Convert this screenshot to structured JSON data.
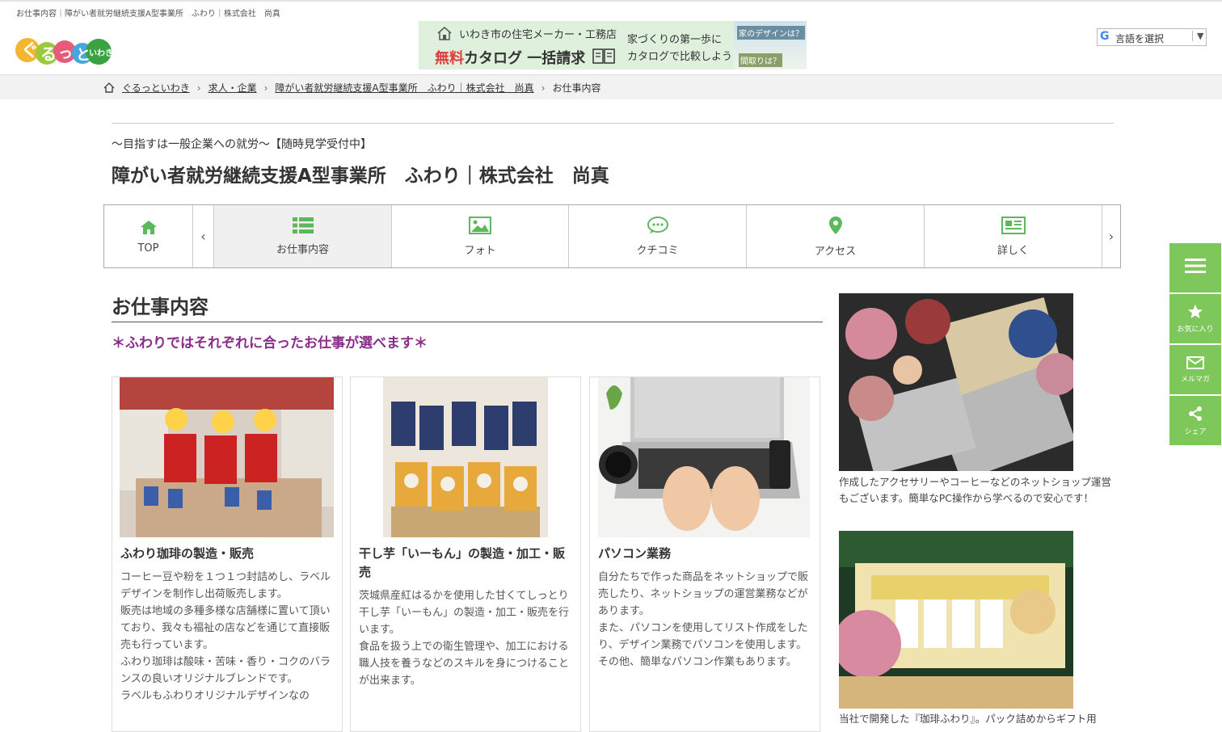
{
  "header": {
    "tiny_title": "お仕事内容｜障がい者就労継続支援A型事業所　ふわり｜株式会社　尚真",
    "logo_alt": "ぐるっといわき"
  },
  "banner": {
    "line1": "いわき市の住宅メーカー・工務店",
    "red": "無料",
    "line2": "カタログ 一括請求",
    "mid1": "家づくりの第一歩に",
    "mid2": "カタログで比較しよう！",
    "right1": "家のデザインは？",
    "right2": "間取りは？"
  },
  "language": {
    "g": "G",
    "label": "言語を選択",
    "arrow": "▼"
  },
  "breadcrumb": {
    "home": "ぐるっといわき",
    "l2": "求人・企業",
    "l3": "障がい者就労継続支援A型事業所　ふわり｜株式会社　尚真",
    "current": "お仕事内容",
    "sep": "›"
  },
  "shop": {
    "catch": "～目指すは一般企業への就労～【随時見学受付中】",
    "name": "障がい者就労継続支援A型事業所　ふわり｜株式会社　尚真"
  },
  "tabs": {
    "prev": "‹",
    "next": "›",
    "top": "TOP",
    "work": "お仕事内容",
    "photo": "フォト",
    "review": "クチコミ",
    "access": "アクセス",
    "detail": "詳しく"
  },
  "section": {
    "title": "お仕事内容",
    "subhead": "＊ふわりではそれぞれに合ったお仕事が選べます＊"
  },
  "cards": [
    {
      "title": "ふわり珈琲の製造・販売",
      "body": "コーヒー豆や粉を１つ１つ封詰めし、ラベルデザインを制作し出荷販売します。\n販売は地域の多種多様な店舗様に置いて頂いており、我々も福祉の店などを通じて直接販売も行っています。\nふわり珈琲は酸味・苦味・香り・コクのバランスの良いオリジナルブレンドです。\nラベルもふわりオリジナルデザインなの"
    },
    {
      "title": "干し芋「いーもん」の製造・加工・販売",
      "body": "茨城県産紅はるかを使用した甘くてしっとり干し芋「いーもん」の製造・加工・販売を行います。\n食品を扱う上での衛生管理や、加工における職人技を養うなどのスキルを身につけることが出来ます。"
    },
    {
      "title": "パソコン業務",
      "body": "自分たちで作った商品をネットショップで販売したり、ネットショップの運営業務などがあります。\nまた、パソコンを使用してリスト作成をしたり、デザイン業務でパソコンを使用します。\nその他、簡単なパソコン作業もあります。"
    }
  ],
  "side": {
    "cap1": "作成したアクセサリーやコーヒーなどのネットショップ運営もございます。簡単なPC操作から学べるので安心です！",
    "cap2": "当社で開発した『珈琲ふわり』。パック詰めからギフト用"
  },
  "floating": {
    "fav": "お気に入り",
    "mail": "メルマガ",
    "share": "シェア"
  },
  "colors": {
    "accent_green": "#5cb85c",
    "fab_green": "#7dc75b",
    "subhead_purple": "#8a2c8a"
  }
}
